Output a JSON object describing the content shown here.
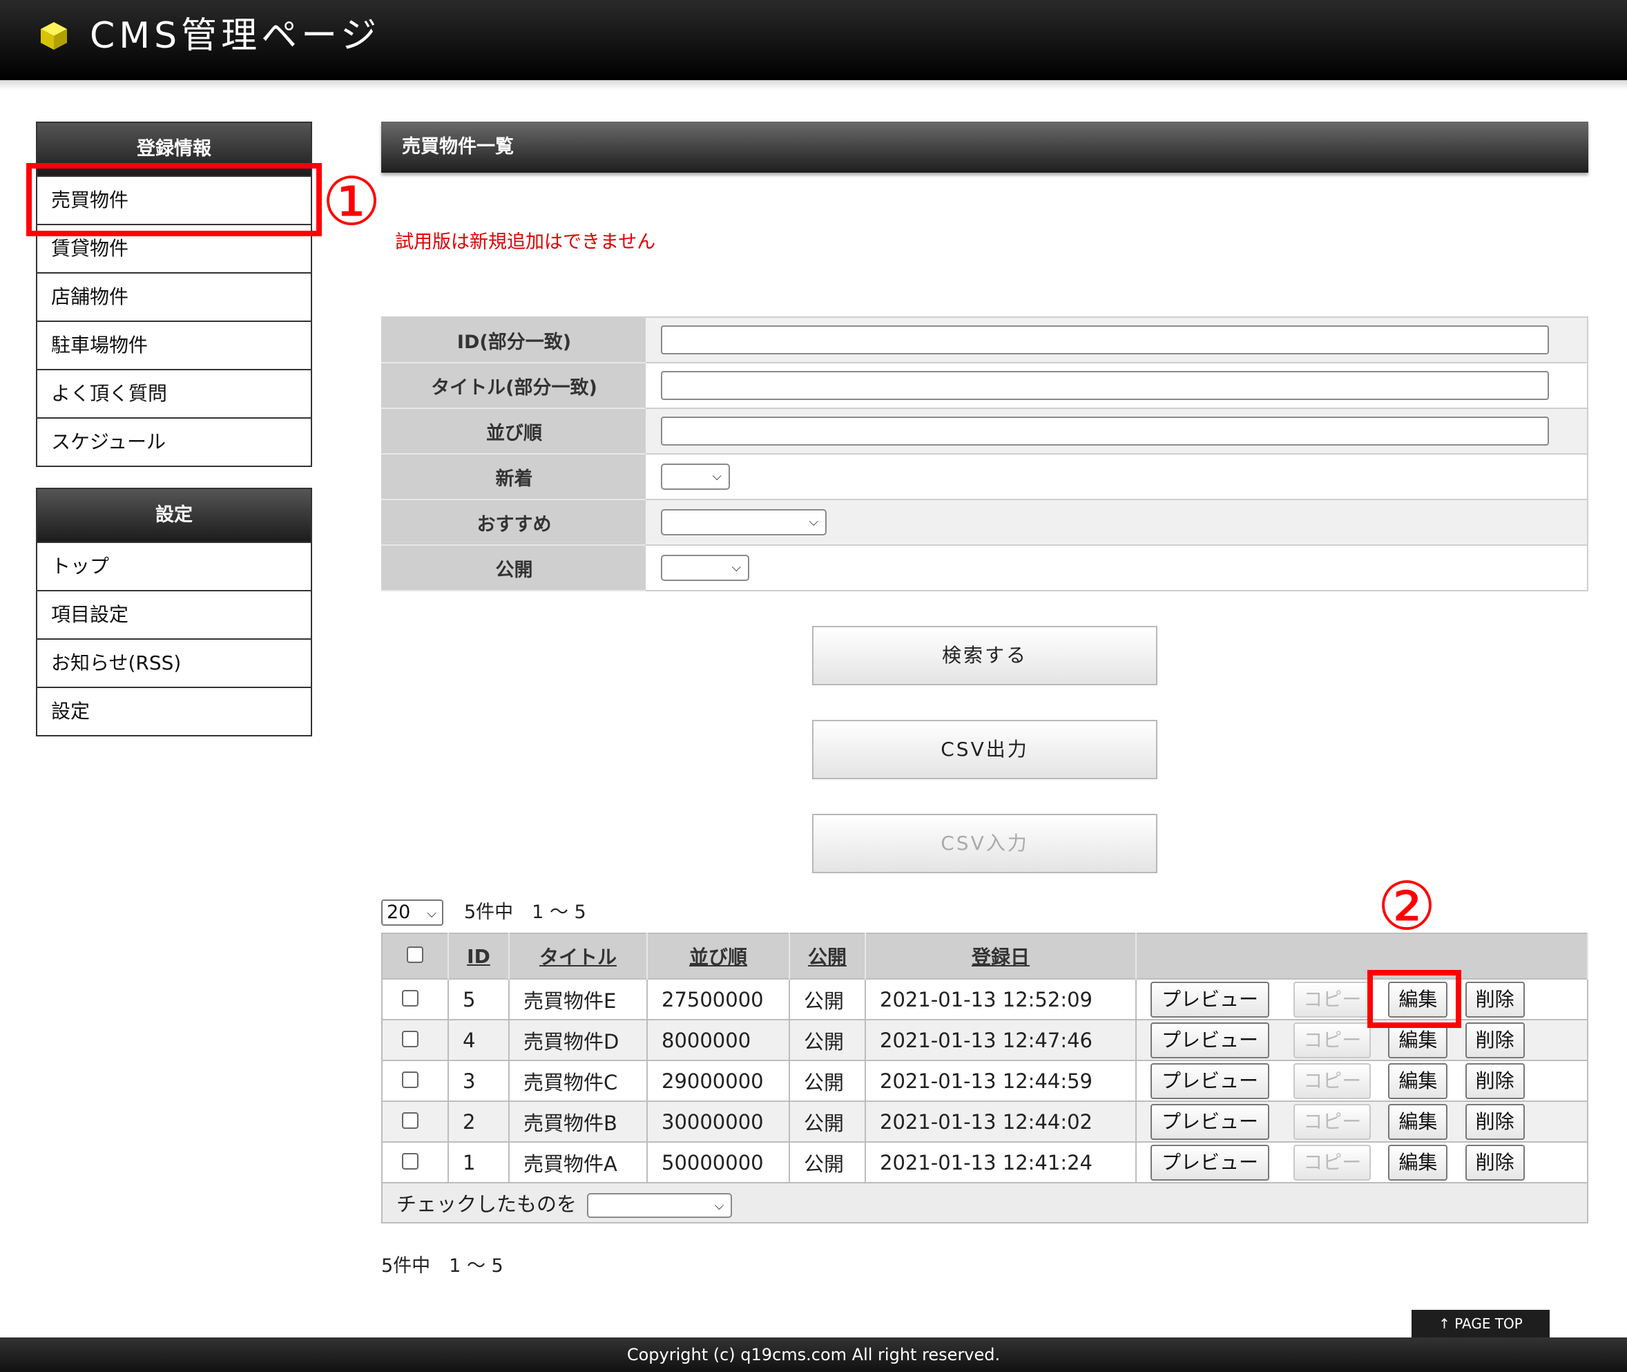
{
  "header": {
    "title": "CMS管理ページ",
    "logo_icon": "cube-icon",
    "logo_color": "#e8d800"
  },
  "sidebar": {
    "group1": {
      "title": "登録情報",
      "items": [
        "売買物件",
        "賃貸物件",
        "店舗物件",
        "駐車場物件",
        "よく頂く質問",
        "スケジュール"
      ]
    },
    "group2": {
      "title": "設定",
      "items": [
        "トップ",
        "項目設定",
        "お知らせ(RSS)",
        "設定"
      ]
    }
  },
  "annotations": {
    "one": "①",
    "two": "②",
    "color": "#ff0000"
  },
  "main": {
    "heading": "売買物件一覧",
    "notice": "試用版は新規追加はできません",
    "notice_color": "#e00000",
    "search": {
      "fields": [
        {
          "label": "ID(部分一致)",
          "value": ""
        },
        {
          "label": "タイトル(部分一致)",
          "value": ""
        },
        {
          "label": "並び順",
          "value": ""
        },
        {
          "label": "新着",
          "value": ""
        },
        {
          "label": "おすすめ",
          "value": ""
        },
        {
          "label": "公開",
          "value": ""
        }
      ]
    },
    "buttons": {
      "search": "検索する",
      "csv_out": "CSV出力",
      "csv_in": "CSV入力"
    },
    "pager": {
      "per_page": "20",
      "count": "5件中　1 〜 5"
    },
    "table": {
      "headers": [
        "ID",
        "タイトル",
        "並び順",
        "公開",
        "登録日"
      ],
      "rows": [
        {
          "id": "5",
          "title": "売買物件E",
          "order": "27500000",
          "status": "公開",
          "date": "2021-01-13 12:52:09"
        },
        {
          "id": "4",
          "title": "売買物件D",
          "order": "8000000",
          "status": "公開",
          "date": "2021-01-13 12:47:46"
        },
        {
          "id": "3",
          "title": "売買物件C",
          "order": "29000000",
          "status": "公開",
          "date": "2021-01-13 12:44:59"
        },
        {
          "id": "2",
          "title": "売買物件B",
          "order": "30000000",
          "status": "公開",
          "date": "2021-01-13 12:44:02"
        },
        {
          "id": "1",
          "title": "売買物件A",
          "order": "50000000",
          "status": "公開",
          "date": "2021-01-13 12:41:24"
        }
      ],
      "actions": {
        "preview": "プレビュー",
        "copy": "コピー",
        "edit": "編集",
        "delete": "削除"
      },
      "bulk_label": "チェックしたものを",
      "bulk_value": ""
    },
    "count_bottom": "5件中　1 〜 5"
  },
  "pagetop": "↑ PAGE TOP",
  "footer": "Copyright (c) q19cms.com All right reserved."
}
